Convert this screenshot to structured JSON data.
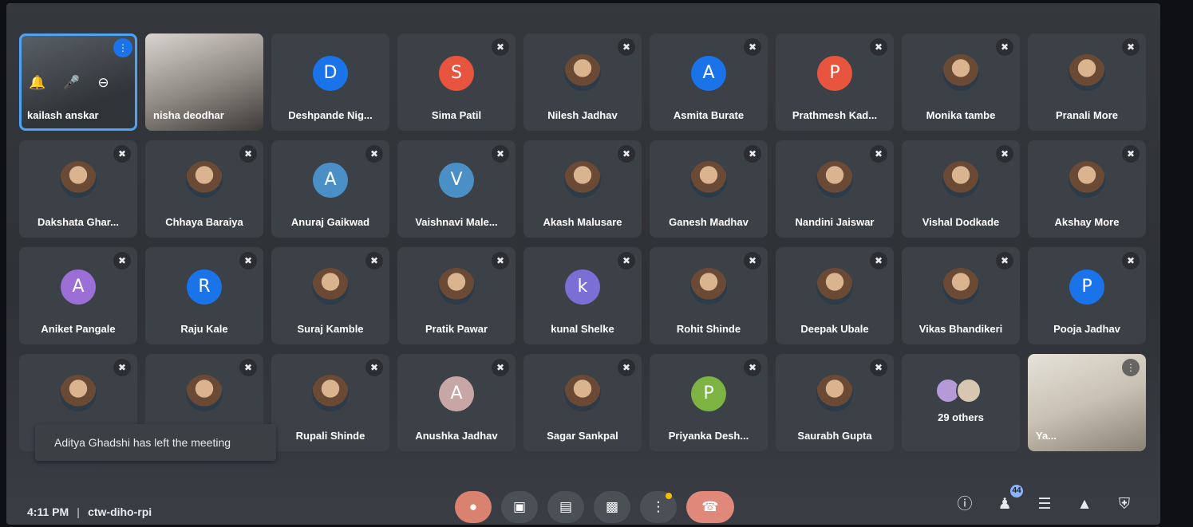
{
  "toolbar_colors": {
    "accent": "#1a73e8",
    "end_call": "#e0897a"
  },
  "self_tile": {
    "name": "kailash anskar",
    "controls": [
      "bell-icon",
      "mic-icon",
      "minus-circle-icon"
    ]
  },
  "participants": [
    {
      "name": "nisha deodhar",
      "kind": "video"
    },
    {
      "name": "Deshpande Nig...",
      "kind": "letter",
      "letter": "D",
      "color": "#1a73e8",
      "muted": false
    },
    {
      "name": "Sima Patil",
      "kind": "letter",
      "letter": "S",
      "color": "#e8553e",
      "muted": true
    },
    {
      "name": "Nilesh Jadhav",
      "kind": "photo",
      "muted": true
    },
    {
      "name": "Asmita Burate",
      "kind": "letter",
      "letter": "A",
      "color": "#1a73e8",
      "muted": true
    },
    {
      "name": "Prathmesh Kad...",
      "kind": "letter",
      "letter": "P",
      "color": "#e8553e",
      "muted": true
    },
    {
      "name": "Monika tambe",
      "kind": "photo",
      "muted": true
    },
    {
      "name": "Pranali More",
      "kind": "photo",
      "muted": true
    },
    {
      "name": "Dakshata Ghar...",
      "kind": "photo",
      "muted": true
    },
    {
      "name": "Chhaya Baraiya",
      "kind": "photo",
      "muted": true
    },
    {
      "name": "Anuraj Gaikwad",
      "kind": "letter",
      "letter": "A",
      "color": "#4a90c6",
      "muted": true
    },
    {
      "name": "Vaishnavi Male...",
      "kind": "letter",
      "letter": "V",
      "color": "#4a90c6",
      "muted": true
    },
    {
      "name": "Akash Malusare",
      "kind": "photo",
      "muted": true
    },
    {
      "name": "Ganesh Madhav",
      "kind": "photo",
      "muted": true
    },
    {
      "name": "Nandini Jaiswar",
      "kind": "photo",
      "muted": true
    },
    {
      "name": "Vishal Dodkade",
      "kind": "photo",
      "muted": true
    },
    {
      "name": "Akshay More",
      "kind": "photo",
      "muted": true
    },
    {
      "name": "Aniket Pangale",
      "kind": "letter",
      "letter": "A",
      "color": "#9c6fd6",
      "muted": true
    },
    {
      "name": "Raju Kale",
      "kind": "letter",
      "letter": "R",
      "color": "#1a73e8",
      "muted": true
    },
    {
      "name": "Suraj Kamble",
      "kind": "photo",
      "muted": true
    },
    {
      "name": "Pratik Pawar",
      "kind": "photo",
      "muted": true
    },
    {
      "name": "kunal Shelke",
      "kind": "letter",
      "letter": "k",
      "color": "#7b6fd6",
      "muted": true
    },
    {
      "name": "Rohit Shinde",
      "kind": "photo",
      "muted": true
    },
    {
      "name": "Deepak Ubale",
      "kind": "photo",
      "muted": true
    },
    {
      "name": "Vikas Bhandikeri",
      "kind": "photo",
      "muted": true
    },
    {
      "name": "Pooja Jadhav",
      "kind": "letter",
      "letter": "P",
      "color": "#1a73e8",
      "muted": true
    },
    {
      "name": "",
      "kind": "photo",
      "muted": true
    },
    {
      "name": "",
      "kind": "photo",
      "muted": true
    },
    {
      "name": "Rupali Shinde",
      "kind": "photo",
      "muted": true
    },
    {
      "name": "Anushka Jadhav",
      "kind": "letter",
      "letter": "A",
      "color": "#c9a6a6",
      "muted": true
    },
    {
      "name": "Sagar Sankpal",
      "kind": "photo",
      "muted": true
    },
    {
      "name": "Priyanka Desh...",
      "kind": "letter",
      "letter": "P",
      "color": "#7cb342",
      "muted": true
    },
    {
      "name": "Saurabh Gupta",
      "kind": "photo",
      "muted": true
    }
  ],
  "others_tile": {
    "label": "29 others"
  },
  "presenter_tile": {
    "name": "Ya..."
  },
  "toast": "Aditya Ghadshi has left the meeting",
  "bottom": {
    "time": "4:11 PM",
    "separator": "|",
    "meeting_code": "ctw-diho-rpi"
  },
  "people_count": "44"
}
